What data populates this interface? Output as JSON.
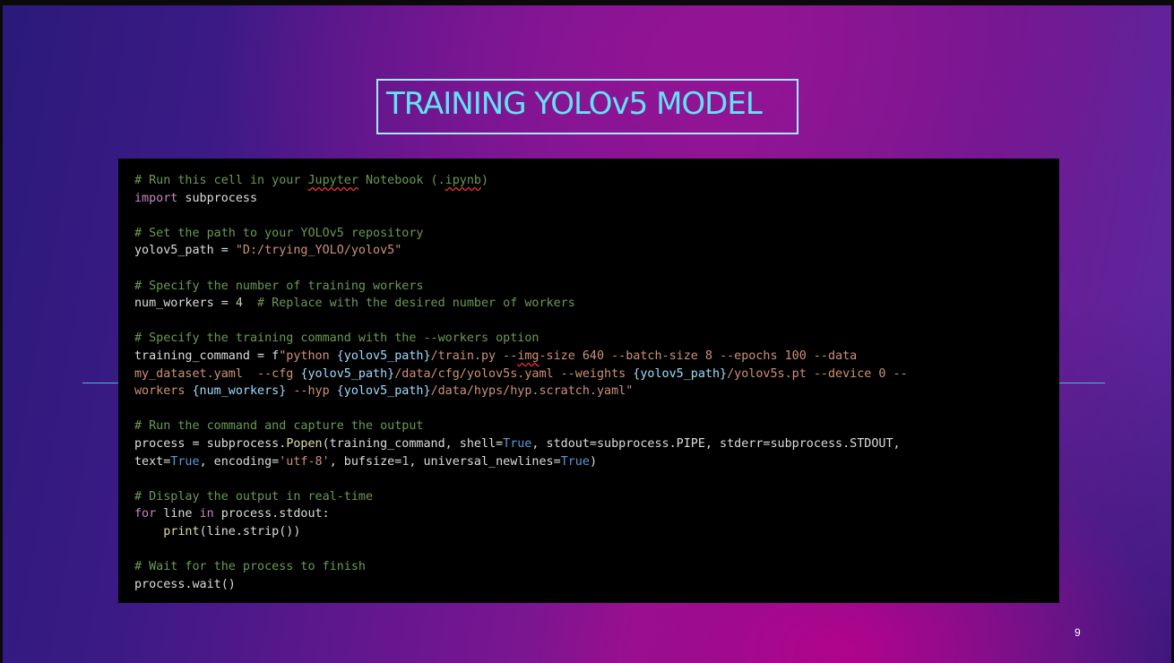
{
  "slide": {
    "title": "TRAINING YOLOv5 MODEL",
    "page_number": "9"
  },
  "code": {
    "line1_comment": "# Run this cell in your ",
    "line1_word_jupyter": "Jupyter",
    "line1_rest": " Notebook (.",
    "line1_word_ipynb": "ipynb",
    "line1_close": ")",
    "line2_keyword": "import",
    "line2_module": " subprocess",
    "line4_comment": "# Set the path to your YOLOv5 repository",
    "line5_var": "yolov5_path = ",
    "line5_value": "\"D:/trying_YOLO/yolov5\"",
    "line7_comment": "# Specify the number of training workers",
    "line8_var": "num_workers = ",
    "line8_num": "4",
    "line8_comment": "  # Replace with the desired number of workers",
    "line10_comment": "# Specify the training command with the --workers option",
    "line11_var": "training_command = f",
    "line11_s1": "\"python ",
    "line11_i1": "{yolov5_path}",
    "line11_s2": "/train.py --",
    "line11_word_img": "img",
    "line11_s3": "-size 640 --batch-size 8 --epochs 100 --data",
    "line12_s1": "my_dataset.yaml  --cfg ",
    "line12_i1": "{yolov5_path}",
    "line12_s2": "/data/cfg/yolov5s.yaml --weights ",
    "line12_i2": "{yolov5_path}",
    "line12_s3": "/yolov5s.pt --device 0 --",
    "line13_s1": "workers ",
    "line13_i1": "{num_workers}",
    "line13_s2": " --hyp ",
    "line13_i2": "{yolov5_path}",
    "line13_s3": "/data/hyps/hyp.scratch.yaml\"",
    "line15_comment": "# Run the command and capture the output",
    "line16_a": "process = subprocess.",
    "line16_func": "Popen",
    "line16_b": "(training_command, shell=",
    "line16_true": "True",
    "line16_c": ", stdout=subprocess.PIPE, stderr=subprocess.STDOUT,",
    "line17_a": "text=",
    "line17_true1": "True",
    "line17_b": ", encoding=",
    "line17_str": "'utf-8'",
    "line17_c": ", bufsize=",
    "line17_num": "1",
    "line17_d": ", universal_newlines=",
    "line17_true2": "True",
    "line17_e": ")",
    "line19_comment": "# Display the output in real-time",
    "line20_for": "for",
    "line20_a": " line ",
    "line20_in": "in",
    "line20_b": " process.stdout:",
    "line21_indent": "    ",
    "line21_print": "print",
    "line21_rest": "(line.strip())",
    "line23_comment": "# Wait for the process to finish",
    "line24_code": "process.wait()"
  }
}
